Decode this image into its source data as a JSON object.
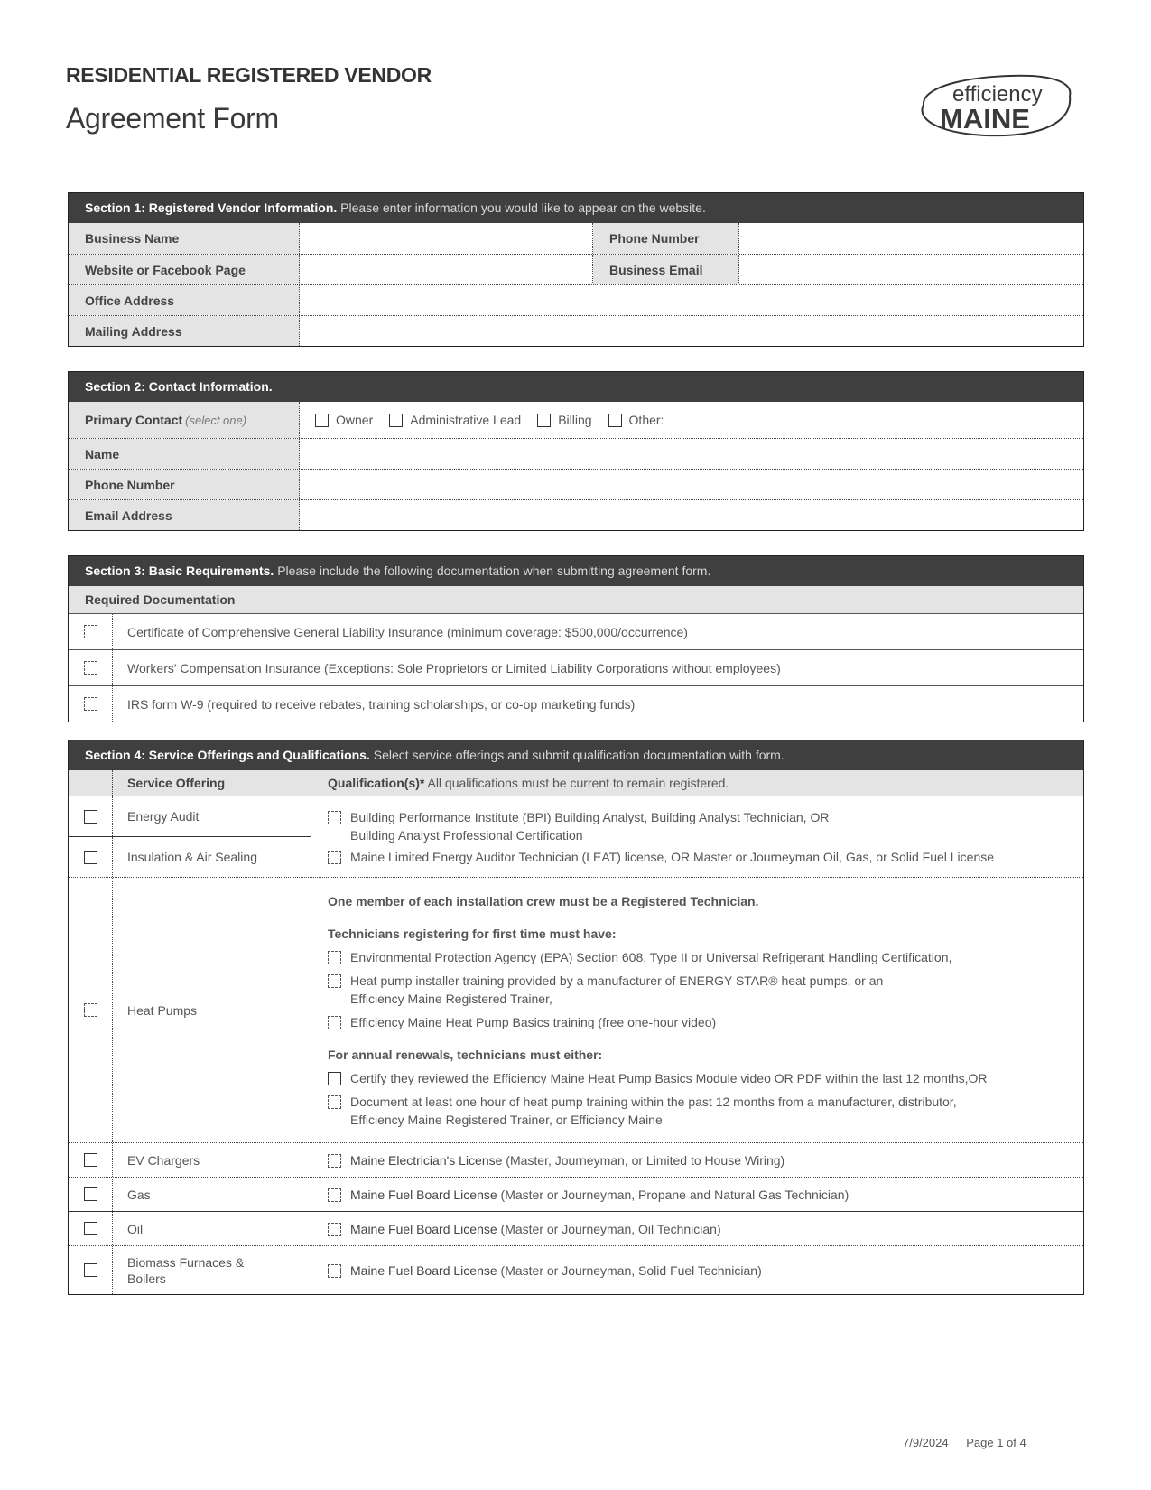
{
  "header": {
    "title_top": "RESIDENTIAL REGISTERED VENDOR",
    "title_sub": "Agreement Form",
    "logo": {
      "line1": "efficiency",
      "line2": "MAINE",
      "icon": "efficiency-maine-logo"
    }
  },
  "section1": {
    "title": "Section 1: Registered Vendor Information.",
    "description": "Please enter information you would like to appear on the website.",
    "fields": {
      "business_name": {
        "label": "Business Name",
        "value": ""
      },
      "phone_number": {
        "label": "Phone Number",
        "value": ""
      },
      "website": {
        "label": "Website or Facebook Page",
        "value": ""
      },
      "business_email": {
        "label": "Business Email",
        "value": ""
      },
      "office_address": {
        "label": "Office Address",
        "value": ""
      },
      "mailing_address": {
        "label": "Mailing Address",
        "value": ""
      }
    }
  },
  "section2": {
    "title": "Section 2: Contact Information.",
    "primary_contact": {
      "label": "Primary Contact",
      "hint": "(select one)",
      "options": [
        "Owner",
        "Administrative Lead",
        "Billing",
        "Other:"
      ]
    },
    "fields": {
      "name": {
        "label": "Name",
        "value": ""
      },
      "phone": {
        "label": "Phone Number",
        "value": ""
      },
      "email": {
        "label": "Email Address",
        "value": ""
      }
    }
  },
  "section3": {
    "title": "Section 3: Basic Requirements.",
    "description": "Please include the following documentation when submitting agreement form.",
    "subheader": "Required Documentation",
    "items": [
      "Certificate of Comprehensive General Liability Insurance (minimum coverage: $500,000/occurrence)",
      "Workers' Compensation Insurance (Exceptions: Sole Proprietors or Limited Liability Corporations without employees)",
      "IRS form W-9 (required to receive rebates, training scholarships, or co-op marketing funds)"
    ]
  },
  "section4": {
    "title": "Section 4: Service Offerings and Qualifications.",
    "description": "Select service offerings and submit qualification documentation with form.",
    "col_service": "Service Offering",
    "col_qual_bold": "Qualification(s)*",
    "col_qual_note": "All qualifications must be current to remain registered.",
    "energy_audit": "Energy Audit",
    "insulation": "Insulation & Air Sealing",
    "audit_quals": [
      {
        "text": "Building Performance Institute (BPI) Building Analyst, Building Analyst Technician, OR",
        "cont": "Building Analyst Professional Certification"
      },
      {
        "text": "Maine Limited Energy Auditor Technician (LEAT) license, OR Master or Journeyman Oil, Gas, or Solid Fuel License"
      }
    ],
    "heat_pumps": {
      "label": "Heat Pumps",
      "intro": "One member of each installation crew must be a Registered Technician.",
      "first_time_header": "Technicians registering for first time must have:",
      "first_time": [
        {
          "text": "Environmental Protection Agency (EPA) Section 608, Type II or Universal Refrigerant Handling Certification,"
        },
        {
          "text": "Heat pump installer training provided by a manufacturer of ENERGY STAR® heat pumps, or an",
          "cont": "Efficiency Maine Registered Trainer,"
        },
        {
          "text": "Efficiency Maine Heat Pump Basics training (free one-hour video)"
        }
      ],
      "renewal_header": "For annual renewals, technicians must either:",
      "renewal": [
        {
          "text": "Certify they reviewed the Efficiency Maine Heat Pump Basics Module video OR PDF within the last 12 months,OR"
        },
        {
          "text": "Document at least one hour of heat pump training within the past 12 months from a manufacturer, distributor,",
          "cont": "Efficiency Maine Registered Trainer, or Efficiency Maine"
        }
      ]
    },
    "rows": [
      {
        "service": "EV Chargers",
        "qual_strong": "Maine Electrician's License",
        "qual_rest": " (Master, Journeyman, or Limited to House Wiring)"
      },
      {
        "service": "Gas",
        "qual_strong": "Maine Fuel Board License",
        "qual_rest": " (Master or Journeyman, Propane and Natural Gas Technician)"
      },
      {
        "service": "Oil",
        "qual_strong": "Maine Fuel Board License",
        "qual_rest": " (Master or Journeyman, Oil Technician)"
      },
      {
        "service": "Biomass Furnaces & Boilers",
        "qual_strong": "Maine Fuel Board License",
        "qual_rest": " (Master or Journeyman, Solid Fuel Technician)"
      }
    ]
  },
  "footer": {
    "date": "7/9/2024",
    "page": "Page 1 of 4"
  }
}
